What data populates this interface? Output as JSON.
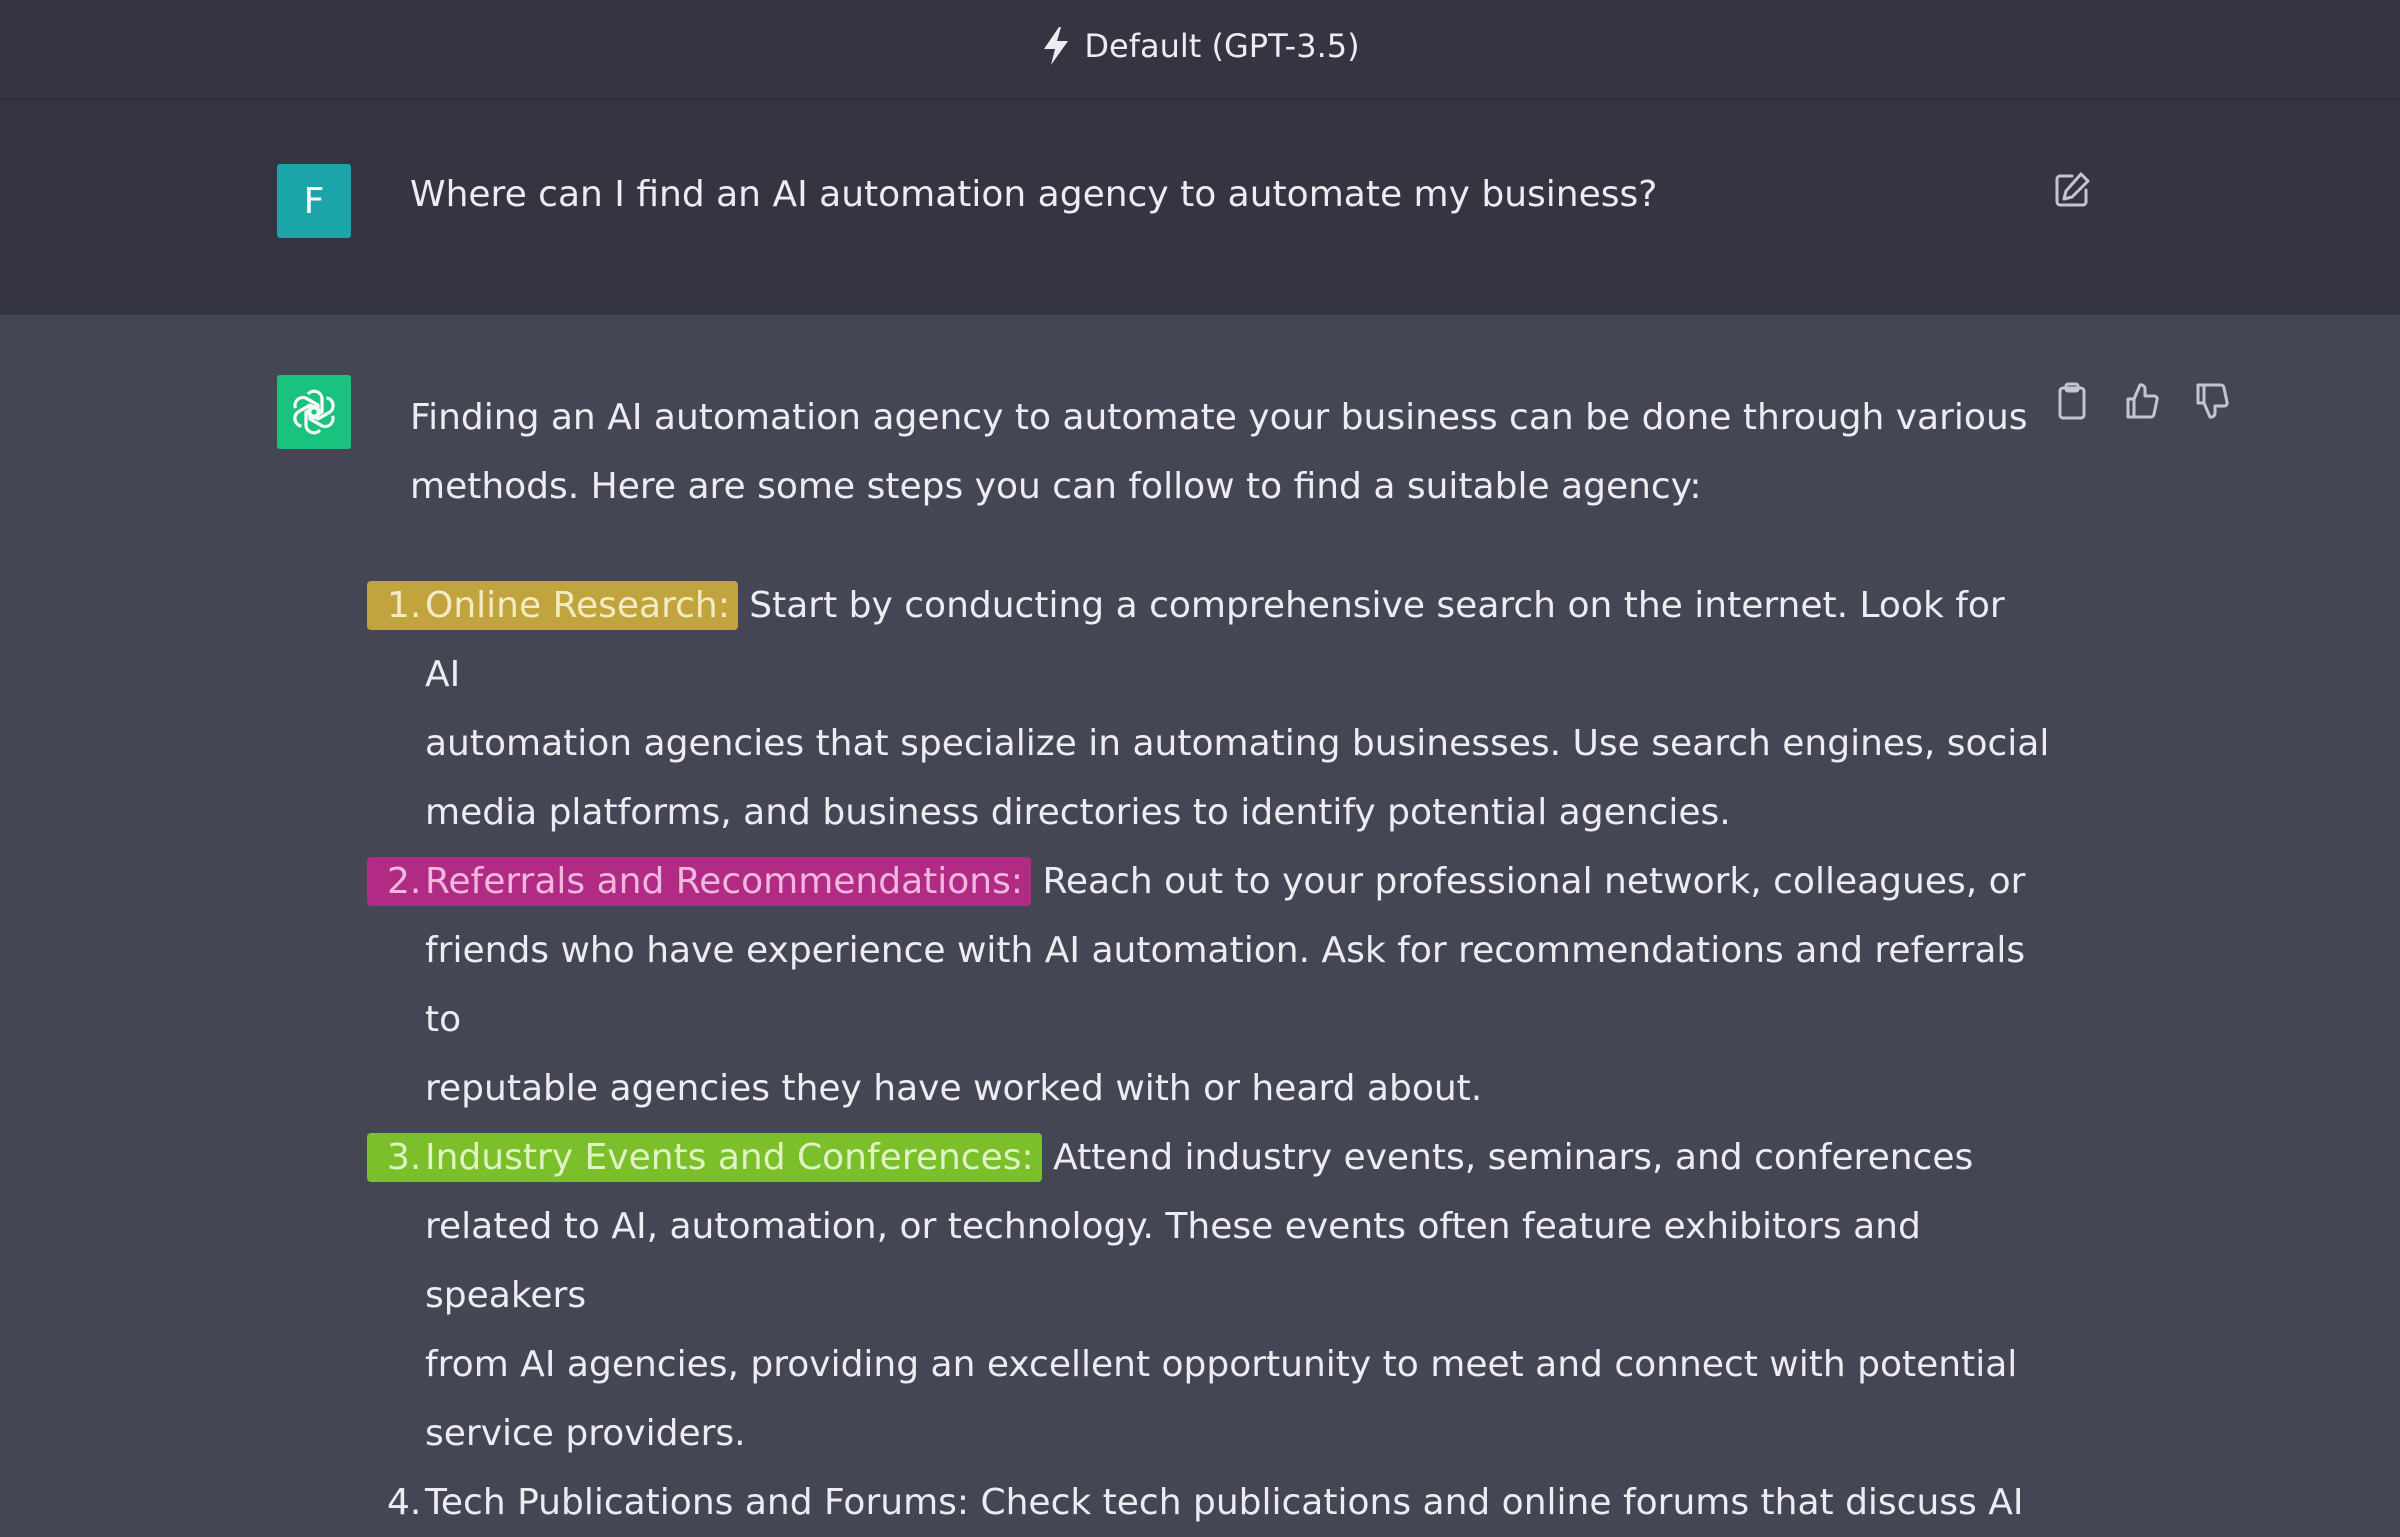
{
  "header": {
    "model_label": "Default (GPT-3.5)",
    "bolt_icon": "lightning-bolt-icon"
  },
  "user_message": {
    "avatar_letter": "F",
    "avatar_color": "#1ba5a8",
    "text": "Where can I find an AI automation agency to automate my business?",
    "edit_icon": "edit-icon"
  },
  "assistant_message": {
    "avatar_icon": "openai-logo-icon",
    "avatar_color": "#19c37d",
    "intro_line_1": "Finding an AI automation agency to automate your business can be done through various",
    "intro_line_2": "methods. Here are some steps you can follow to find a suitable agency:",
    "actions": {
      "copy_icon": "clipboard-icon",
      "like_icon": "thumbs-up-icon",
      "dislike_icon": "thumbs-down-icon"
    },
    "steps": [
      {
        "number": "1.",
        "title": "Online Research:",
        "highlight_color": "#c2a43e",
        "first_line_rest": " Start by conducting a comprehensive search on the internet. Look for AI",
        "lines": [
          "automation agencies that specialize in automating businesses. Use search engines, social",
          "media platforms, and business directories to identify potential agencies."
        ]
      },
      {
        "number": "2.",
        "title": "Referrals and Recommendations:",
        "highlight_color": "#b12a84",
        "first_line_rest": " Reach out to your professional network, colleagues, or",
        "lines": [
          "friends who have experience with AI automation. Ask for recommendations and referrals to",
          "reputable agencies they have worked with or heard about."
        ]
      },
      {
        "number": "3.",
        "title": "Industry Events and Conferences:",
        "highlight_color": "#7bbf2a",
        "first_line_rest": " Attend industry events, seminars, and conferences",
        "lines": [
          "related to AI, automation, or technology. These events often feature exhibitors and speakers",
          "from AI agencies, providing an excellent opportunity to meet and connect with potential",
          "service providers."
        ]
      },
      {
        "number": "4.",
        "title": "Tech Publications and Forums:",
        "highlight_color": "",
        "first_line_rest": " Check tech publications and online forums that discuss AI",
        "lines": []
      }
    ]
  }
}
